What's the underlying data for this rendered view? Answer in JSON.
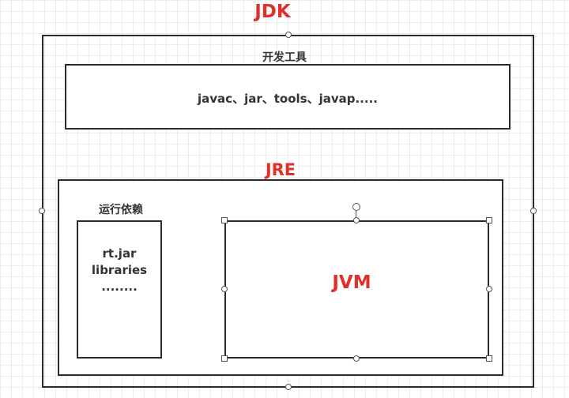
{
  "jdk": {
    "title": "JDK"
  },
  "dev_tools": {
    "title": "开发工具",
    "content": "javac、jar、tools、javap....."
  },
  "jre": {
    "title": "JRE"
  },
  "runtime_deps": {
    "title": "运行依赖",
    "lines": [
      "rt.jar",
      "libraries",
      "........"
    ]
  },
  "jvm": {
    "title": "JVM"
  },
  "colors": {
    "accent_red": "#e0302b",
    "stroke": "#2b2b2b",
    "label_text": "#333333"
  }
}
